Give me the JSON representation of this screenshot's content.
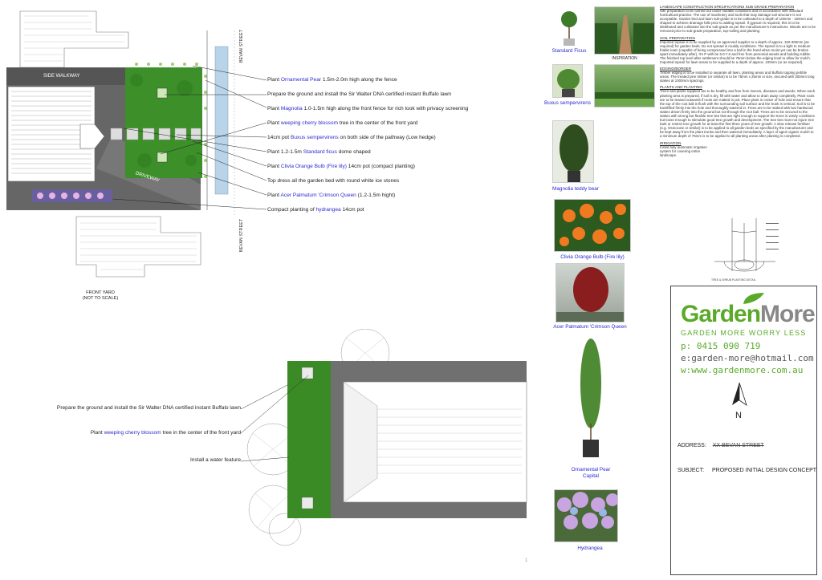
{
  "plan_top": {
    "side_walkway": "SIDE WALKWAY",
    "driveway": "DRIVEWAY",
    "bevan_street_top": "BEVAN STREET",
    "bevan_street_bottom": "BEVAN STREET",
    "front_yard_title": "FRONT YARD",
    "front_yard_scale": "(NOT TO SCALE)",
    "notes": [
      {
        "pre": "Plant ",
        "hl": "Ornamental Pear",
        "post": " 1.5m-2.0m high along the fence"
      },
      {
        "pre": "Prepare the ground and install the Sir Walter DNA certified instant Buffalo lawn",
        "hl": "",
        "post": ""
      },
      {
        "pre": "Plant ",
        "hl": "Magnolia",
        "post": " 1.0-1.5m high along the front fence for rich look with privacy screening"
      },
      {
        "pre": "Plant ",
        "hl": "weeping cherry blossom",
        "post": " tree in the center of the front yard"
      },
      {
        "pre": "14cm pot ",
        "hl": "Buxus sempervirens",
        "post": " on both side of the pathway (Low hedge)"
      },
      {
        "pre": "Plant 1.2-1.5m ",
        "hl": "Standard ficus",
        "post": " dome shaped"
      },
      {
        "pre": "Plant ",
        "hl": "Clivia Orange Bulb (Fire lily)",
        "post": " 14cm pot (compact planting)"
      },
      {
        "pre": "Top dress all the garden bed with round white ice stones",
        "hl": "",
        "post": ""
      },
      {
        "pre": "Plant ",
        "hl": "Acer Palmatum 'Crimson Queen",
        "post": " (1.2-1.5m hight)"
      },
      {
        "pre": "Compact planting of ",
        "hl": "hydrangea",
        "post": " 14cm pot"
      }
    ]
  },
  "plan_bottom": {
    "notes": [
      {
        "pre": "Prepare the ground and install the Sir Walter DNA certified instant Buffalo lawn",
        "hl": "",
        "post": ""
      },
      {
        "pre": "Plant ",
        "hl": "weeping cherry blossom",
        "post": " tree in the center of the front yard"
      },
      {
        "pre": "Install a water feature",
        "hl": "",
        "post": ""
      }
    ],
    "page_marker": "1"
  },
  "photos": {
    "standard_ficus": "Standard Ficus",
    "inspiration": "INSPIRATION",
    "buxus": "Buxus sempervirens",
    "magnolia": "Magnolia teddy bear",
    "clivia": "Clivia Orange Bulb (Fire lily)",
    "acer": "Acer Palmatum 'Crimson Queen",
    "pear_line1": "Ornamental Pear",
    "pear_line2": "Capital",
    "hydrangea": "Hydrangea"
  },
  "specs": [
    {
      "heading": "LANDSCAPE CONSTRUCTION SPECIFICATIONS SUB GRADE PREPARATION",
      "body": "Site preparation to be carried out under suitable conditions and in accordance with standard horticultural practice. The use of machinery and tools that may damage soil structure is not acceptable. Garden bed and lawn sub-grade is to be cultivated to a depth of 100mm - 150mm and shaped to achieve drainage falls prior to adding topsoil. If gypsum is required, this is to be distributed and cultivated into the sub-grade as per the manufacturer's instructions. Weeds are to be removed prior to sub-grade preparation, top-soiling and planting."
    },
    {
      "heading": "SOIL PREPARATION",
      "body": "Imported topsoil is to be supplied by an approved supplier to a depth of approx. 100-300mm (as required) for garden beds. Do not spread in muddy conditions. The topsoil is to a light to medium friable loam (capable of being compressed into a ball in the hand when moist yet can be broken apart immediately after). It's P with be 6.0-7.0 and free from perennial weeds and building rubble. The finished top level after settlement should be 75mm below the edging level to allow for mulch. Imported topsoil for lawn areas to be supplied to a depth of approx. 100mm (or as required)."
    },
    {
      "heading": "EDGING/BORDER",
      "body": "Timber edging is to be installed to separate all lawn, planting areas and Buffalo topping pebble areas. The treated pine timber (or similar) is to be 75mm x 25mm in size, secured with 300mm long stakes at 1000mm spacings."
    },
    {
      "heading": "PLANTS AND PLANTING",
      "body": "Trees and plants supplied are to be healthy and free from insects, diseases and weeds. When each planting area is prepared, if soil is dry, fill with water and allow to drain away completely. Plant roots are to be teased outwards if roots are matted in pot. Place plant in center of hole and ensure that the top of the root ball is flush with the surrounding soil surface and the trunk is vertical. Soil is to be backfilled firmly into the hole and thoroughly watered in. Trees are to be staked with two hardwood stakes driven firmly into the ground but not through the root ball. Trees are to be secured to the stakes with strong but flexible tree ties that are tight enough to support the trees in windy conditions but loose enough to stimulate good tree growth and development. The tree ties must not injure tree bark or restrict tree growth for at least the first three years of tree growth. A slow release fertiliser (e.g. Osmocote or similar) is to be applied to all garden beds as specified by the manufacturer and be kept away from the plant trunks and then watered immediately. A layer of aged organic mulch to a minimum depth of 75mm is to be applied to all planting areas after planting is completed."
    },
    {
      "heading": "IRRIGATION",
      "body": "Install fully automatic irrigation system for covering entire landscape."
    }
  ],
  "detail_caption": "TREE & SHRUB PLANTING DETAIL",
  "brand": {
    "name_part1": "Garden",
    "name_part2": "More",
    "tagline": "GARDEN MORE WORRY LESS",
    "phone": "p: 0415 090 719",
    "email": "e:garden-more@hotmail.com",
    "web": "w:www.gardenmore.com.au",
    "north": "N",
    "address_label": "ADDRESS:",
    "address_value": "XX BEVAN STREET",
    "subject_label": "SUBJECT:",
    "subject_value": "PROPOSED INITIAL DESIGN CONCEPT",
    "green": "#5aaa2a",
    "gray": "#888888"
  }
}
